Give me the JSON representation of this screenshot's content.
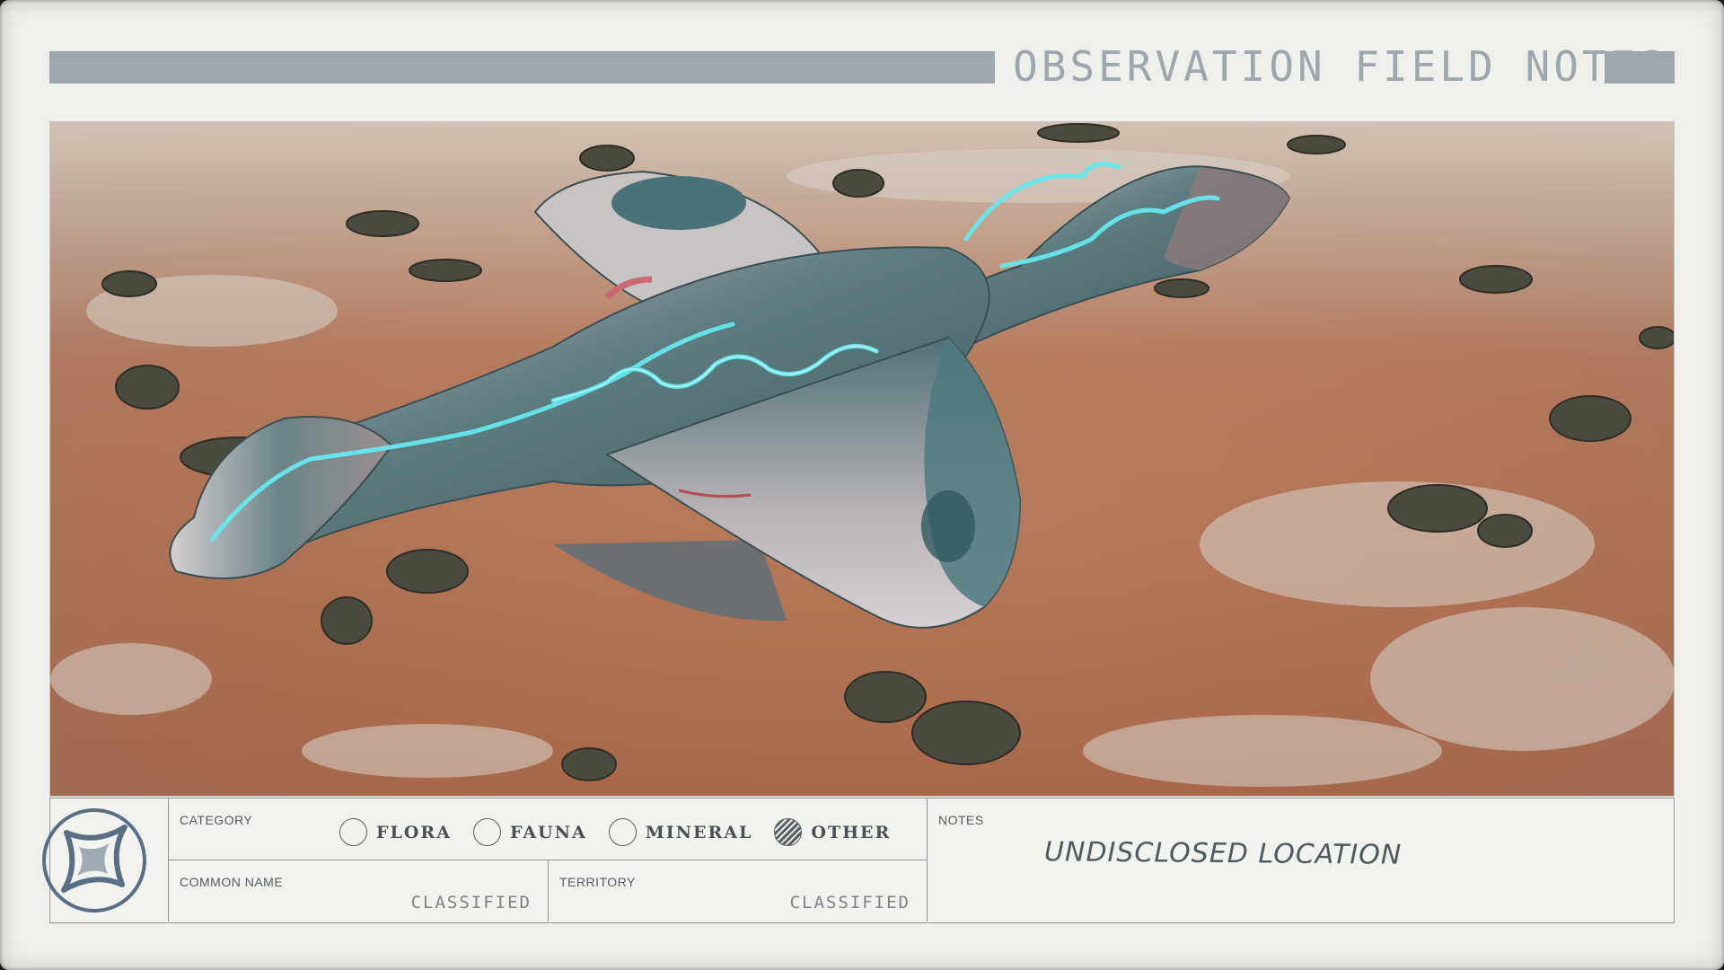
{
  "header": {
    "title": "OBSERVATION FIELD NOTES",
    "accent_color": "#9ea7ad"
  },
  "photo": {
    "subject_icon": "creature-photo"
  },
  "category": {
    "label": "CATEGORY",
    "options": [
      {
        "label": "FLORA",
        "checked": false
      },
      {
        "label": "FAUNA",
        "checked": false
      },
      {
        "label": "MINERAL",
        "checked": false
      },
      {
        "label": "OTHER",
        "checked": true
      }
    ]
  },
  "common_name": {
    "label": "COMMON NAME",
    "value": "CLASSIFIED"
  },
  "territory": {
    "label": "TERRITORY",
    "value": "CLASSIFIED"
  },
  "notes": {
    "label": "NOTES",
    "value": "UNDISCLOSED LOCATION"
  },
  "logo": {
    "icon": "constellation-star-icon"
  }
}
